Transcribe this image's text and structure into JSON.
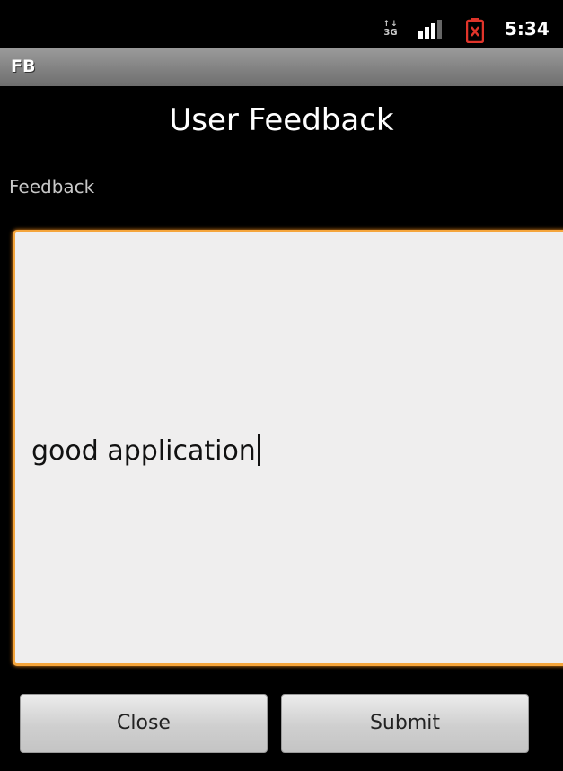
{
  "status_bar": {
    "network_label": "3G",
    "network_arrows": "↑↓",
    "clock": "5:34",
    "icons": [
      "network-3g-icon",
      "signal-strength-icon",
      "battery-alert-icon"
    ],
    "battery_color": "#e0342a"
  },
  "app": {
    "name": "FB"
  },
  "screen": {
    "title": "User Feedback",
    "field_label": "Feedback"
  },
  "feedback": {
    "value": "good application",
    "focus_color": "#f5a53b"
  },
  "buttons": {
    "close_label": "Close",
    "submit_label": "Submit"
  }
}
